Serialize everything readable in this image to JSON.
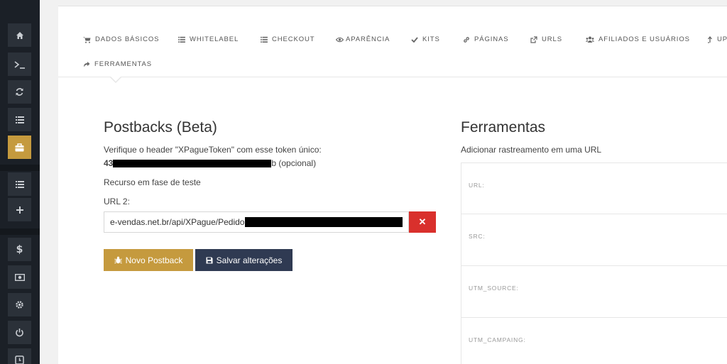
{
  "sidebar": {
    "icons": [
      "home-icon",
      "terminal-icon",
      "refresh-icon",
      "list-icon",
      "briefcase-icon",
      "list-icon",
      "plus-icon",
      "dollar-icon",
      "money-icon",
      "gear-icon",
      "power-icon",
      "clock-icon"
    ],
    "active_icon": "briefcase-icon",
    "dollar_glyph": "$"
  },
  "tabs": [
    {
      "label": "DADOS BÁSICOS",
      "icon": "cart-icon"
    },
    {
      "label": "WHITELABEL",
      "icon": "list-icon"
    },
    {
      "label": "CHECKOUT",
      "icon": "list-icon"
    },
    {
      "label": "APARÊNCIA",
      "icon": "eye-icon"
    },
    {
      "label": "KITS",
      "icon": "check-icon"
    },
    {
      "label": "PÁGINAS",
      "icon": "link-icon"
    },
    {
      "label": "URLS",
      "icon": "external-link-icon"
    },
    {
      "label": "AFILIADOS E USUÁRIOS",
      "icon": "users-icon"
    },
    {
      "label": "UP",
      "icon": "upload-icon"
    },
    {
      "label": "FERRAMENTAS",
      "icon": "share-icon"
    }
  ],
  "postbacks": {
    "title": "Postbacks (Beta)",
    "description": "Verifique o header \"XPagueToken\" com esse token único:",
    "token_prefix": "43",
    "token_suffix": "b (opcional)",
    "feature_note": "Recurso em fase de teste",
    "url_label": "URL 2:",
    "url_value": "e-vendas.net.br/api/XPague/Pedido",
    "delete_glyph": "✕",
    "new_button": "Novo Postback",
    "save_button": "Salvar alterações"
  },
  "ferramentas": {
    "title": "Ferramentas",
    "subtitle": "Adicionar rastreamento em uma URL",
    "fields": [
      "URL:",
      "SRC:",
      "UTM_SOURCE:",
      "UTM_CAMPAING:"
    ]
  },
  "colors": {
    "sidebar_bg": "#1b2027",
    "accent_gold": "#c59a3e",
    "dark_button": "#2f3a52",
    "danger": "#d9302c"
  }
}
